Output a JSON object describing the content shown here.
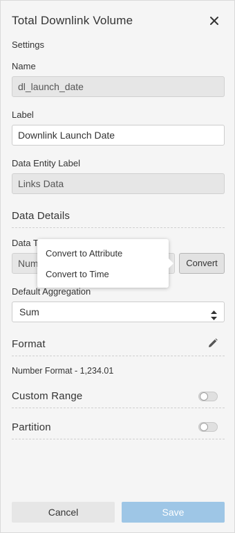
{
  "panel": {
    "title": "Total Downlink Volume",
    "settings_caption": "Settings"
  },
  "name": {
    "label": "Name",
    "value": "dl_launch_date"
  },
  "display_label": {
    "label": "Label",
    "value": "Downlink Launch Date"
  },
  "entity": {
    "label": "Data Entity Label",
    "value": "Links Data"
  },
  "data_details": {
    "heading": "Data Details",
    "data_type_label_visible": "Data T",
    "data_type_value_visible": "Num",
    "convert_button": "Convert",
    "convert_menu": [
      "Convert to Attribute",
      "Convert to Time"
    ]
  },
  "aggregation": {
    "label": "Default Aggregation",
    "value": "Sum"
  },
  "format": {
    "heading": "Format",
    "number_format": "Number Format - 1,234.01"
  },
  "custom_range": {
    "heading": "Custom Range",
    "enabled": false
  },
  "partition": {
    "heading": "Partition",
    "enabled": false
  },
  "footer": {
    "cancel": "Cancel",
    "save": "Save"
  },
  "icons": {
    "close": "close-icon",
    "edit": "pencil-icon",
    "select_arrows": "sort-arrows-icon"
  },
  "colors": {
    "save_button": "#9ec6e6",
    "panel_bg": "#f5f5f5"
  }
}
